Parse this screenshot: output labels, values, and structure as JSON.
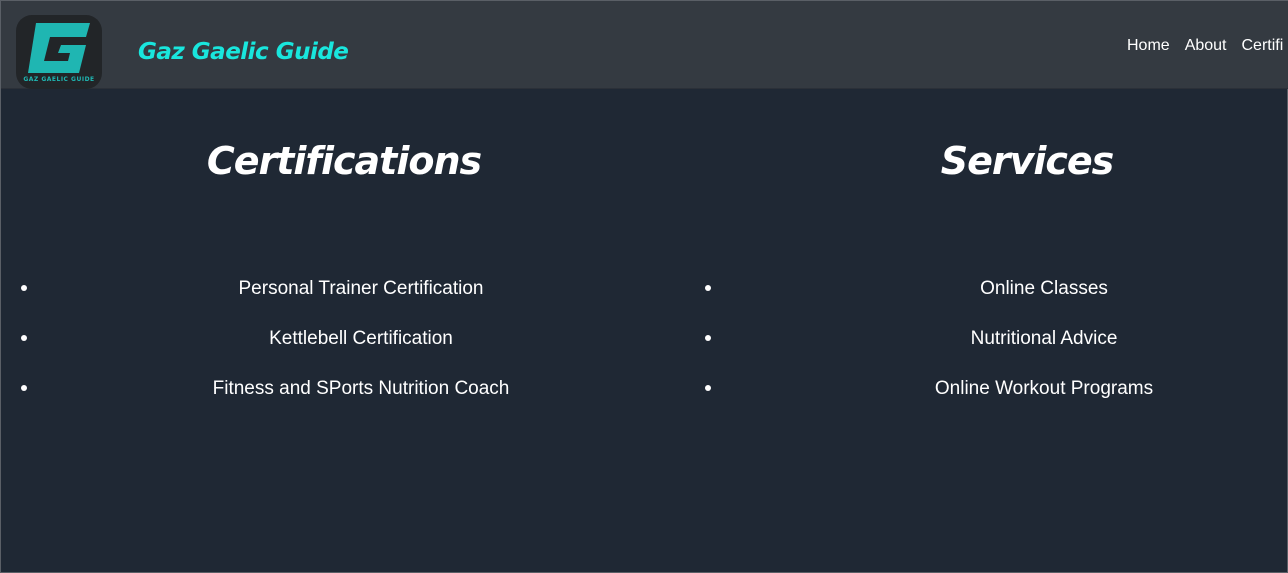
{
  "navbar": {
    "logo_text": "GAZ GAELIC GUIDE",
    "brand": "Gaz Gaelic Guide",
    "links": [
      "Home",
      "About",
      "Certifi"
    ]
  },
  "certifications": {
    "title": "Certifications",
    "items": [
      "Personal Trainer Certification",
      "Kettlebell Certification",
      "Fitness and SPorts Nutrition Coach"
    ]
  },
  "services": {
    "title": "Services",
    "items": [
      "Online Classes",
      "Nutritional Advice",
      "Online Workout Programs"
    ]
  },
  "colors": {
    "background": "#1f2834",
    "navbar": "#343a41",
    "brand": "#19e6dd",
    "logo_teal": "#1fb6b2"
  }
}
